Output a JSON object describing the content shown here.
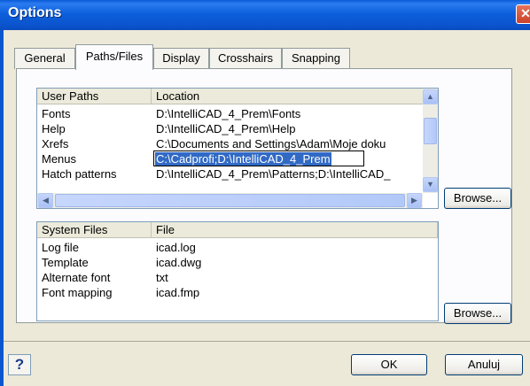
{
  "window": {
    "title": "Options"
  },
  "tabs": [
    {
      "label": "General"
    },
    {
      "label": "Paths/Files"
    },
    {
      "label": "Display"
    },
    {
      "label": "Crosshairs"
    },
    {
      "label": "Snapping"
    }
  ],
  "active_tab": "Paths/Files",
  "user_paths": {
    "headers": [
      "User Paths",
      "Location"
    ],
    "rows": [
      {
        "name": "Fonts",
        "location": "D:\\IntelliCAD_4_Prem\\Fonts"
      },
      {
        "name": "Help",
        "location": "D:\\IntelliCAD_4_Prem\\Help"
      },
      {
        "name": "Xrefs",
        "location": "C:\\Documents and Settings\\Adam\\Moje doku"
      },
      {
        "name": "Menus",
        "location": "C:\\Cadprofi;D:\\IntelliCAD_4_Prem"
      },
      {
        "name": "Hatch patterns",
        "location": "D:\\IntelliCAD_4_Prem\\Patterns;D:\\IntelliCAD_"
      }
    ],
    "editing_row": "Menus"
  },
  "system_files": {
    "headers": [
      "System Files",
      "File"
    ],
    "rows": [
      {
        "name": "Log file",
        "file": "icad.log"
      },
      {
        "name": "Template",
        "file": "icad.dwg"
      },
      {
        "name": "Alternate font",
        "file": "txt"
      },
      {
        "name": "Font mapping",
        "file": "icad.fmp"
      }
    ]
  },
  "buttons": {
    "browse_top": "Browse...",
    "browse_bottom": "Browse...",
    "ok": "OK",
    "cancel": "Anuluj",
    "help": "?"
  },
  "icons": {
    "close": "close-icon",
    "scroll_up": "arrow-up-icon",
    "scroll_down": "arrow-down-icon",
    "scroll_left": "arrow-left-icon",
    "scroll_right": "arrow-right-icon"
  },
  "colors": {
    "titlebar": "#0b55cf",
    "selection": "#316ac5",
    "dialog_bg": "#ece9d8"
  }
}
